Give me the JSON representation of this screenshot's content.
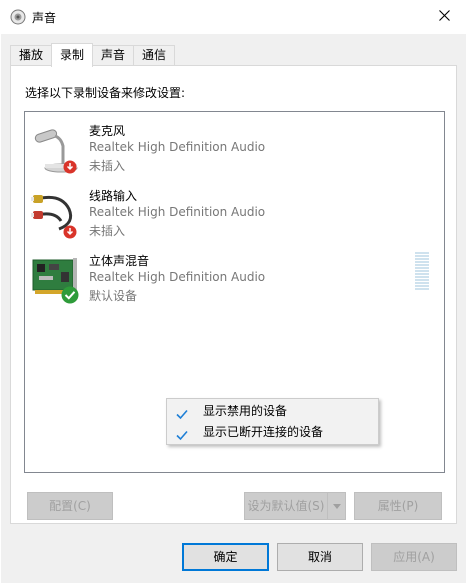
{
  "window": {
    "title": "声音",
    "icon": "speaker-icon",
    "close_icon": "close-icon"
  },
  "tabs": [
    {
      "label": "播放"
    },
    {
      "label": "录制",
      "active": true
    },
    {
      "label": "声音"
    },
    {
      "label": "通信"
    }
  ],
  "panel": {
    "instruction": "选择以下录制设备来修改设置:"
  },
  "devices": [
    {
      "name": "麦克风",
      "driver": "Realtek High Definition Audio",
      "status": "未插入",
      "icon": "microphone-icon",
      "badge": "unplugged-badge-icon"
    },
    {
      "name": "线路输入",
      "driver": "Realtek High Definition Audio",
      "status": "未插入",
      "icon": "line-in-cable-icon",
      "badge": "unplugged-badge-icon"
    },
    {
      "name": "立体声混音",
      "driver": "Realtek High Definition Audio",
      "status": "默认设备",
      "icon": "sound-card-icon",
      "badge": "default-check-badge-icon",
      "level_meter": true
    }
  ],
  "context_menu": {
    "items": [
      {
        "label": "显示禁用的设备",
        "checked": true
      },
      {
        "label": "显示已断开连接的设备",
        "checked": true
      }
    ]
  },
  "panel_buttons": {
    "configure": "配置(C)",
    "set_default": "设为默认值(S)",
    "properties": "属性(P)"
  },
  "dialog_buttons": {
    "ok": "确定",
    "cancel": "取消",
    "apply": "应用(A)"
  },
  "colors": {
    "accent": "#0078d7",
    "check": "#1e7fd6",
    "badge_red": "#d9342a",
    "badge_green": "#2e9b3a"
  }
}
